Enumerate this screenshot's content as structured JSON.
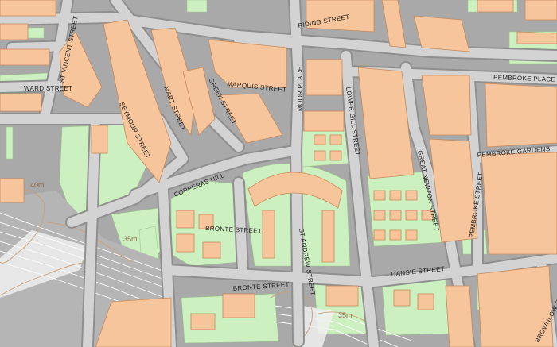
{
  "map": {
    "streets": [
      "RIDING STREET",
      "ST VINCENT STREET",
      "WARD STREET",
      "MARQUIS STREET",
      "MOOR PLACE",
      "LOWER GILL STREET",
      "PEMBROKE PLACE",
      "PEMBROKE GARDENS",
      "GREEK STREET",
      "MART STREET",
      "SEYMOUR STREET",
      "COPPERAS HILL",
      "GREAT NEWTON STREET",
      "PEMBROKE STREET",
      "BRONTE STREET",
      "ST ANDREW STREET",
      "BRONTE STREET",
      "DANSIE STREET",
      "BROWNLOW STREET"
    ],
    "heights": [
      "40m",
      "35m",
      "35m"
    ],
    "colors": {
      "road": "#d3d3d3",
      "building": "#f6c59c",
      "green": "#ccf0bf",
      "background": "#a9a9a9"
    }
  }
}
